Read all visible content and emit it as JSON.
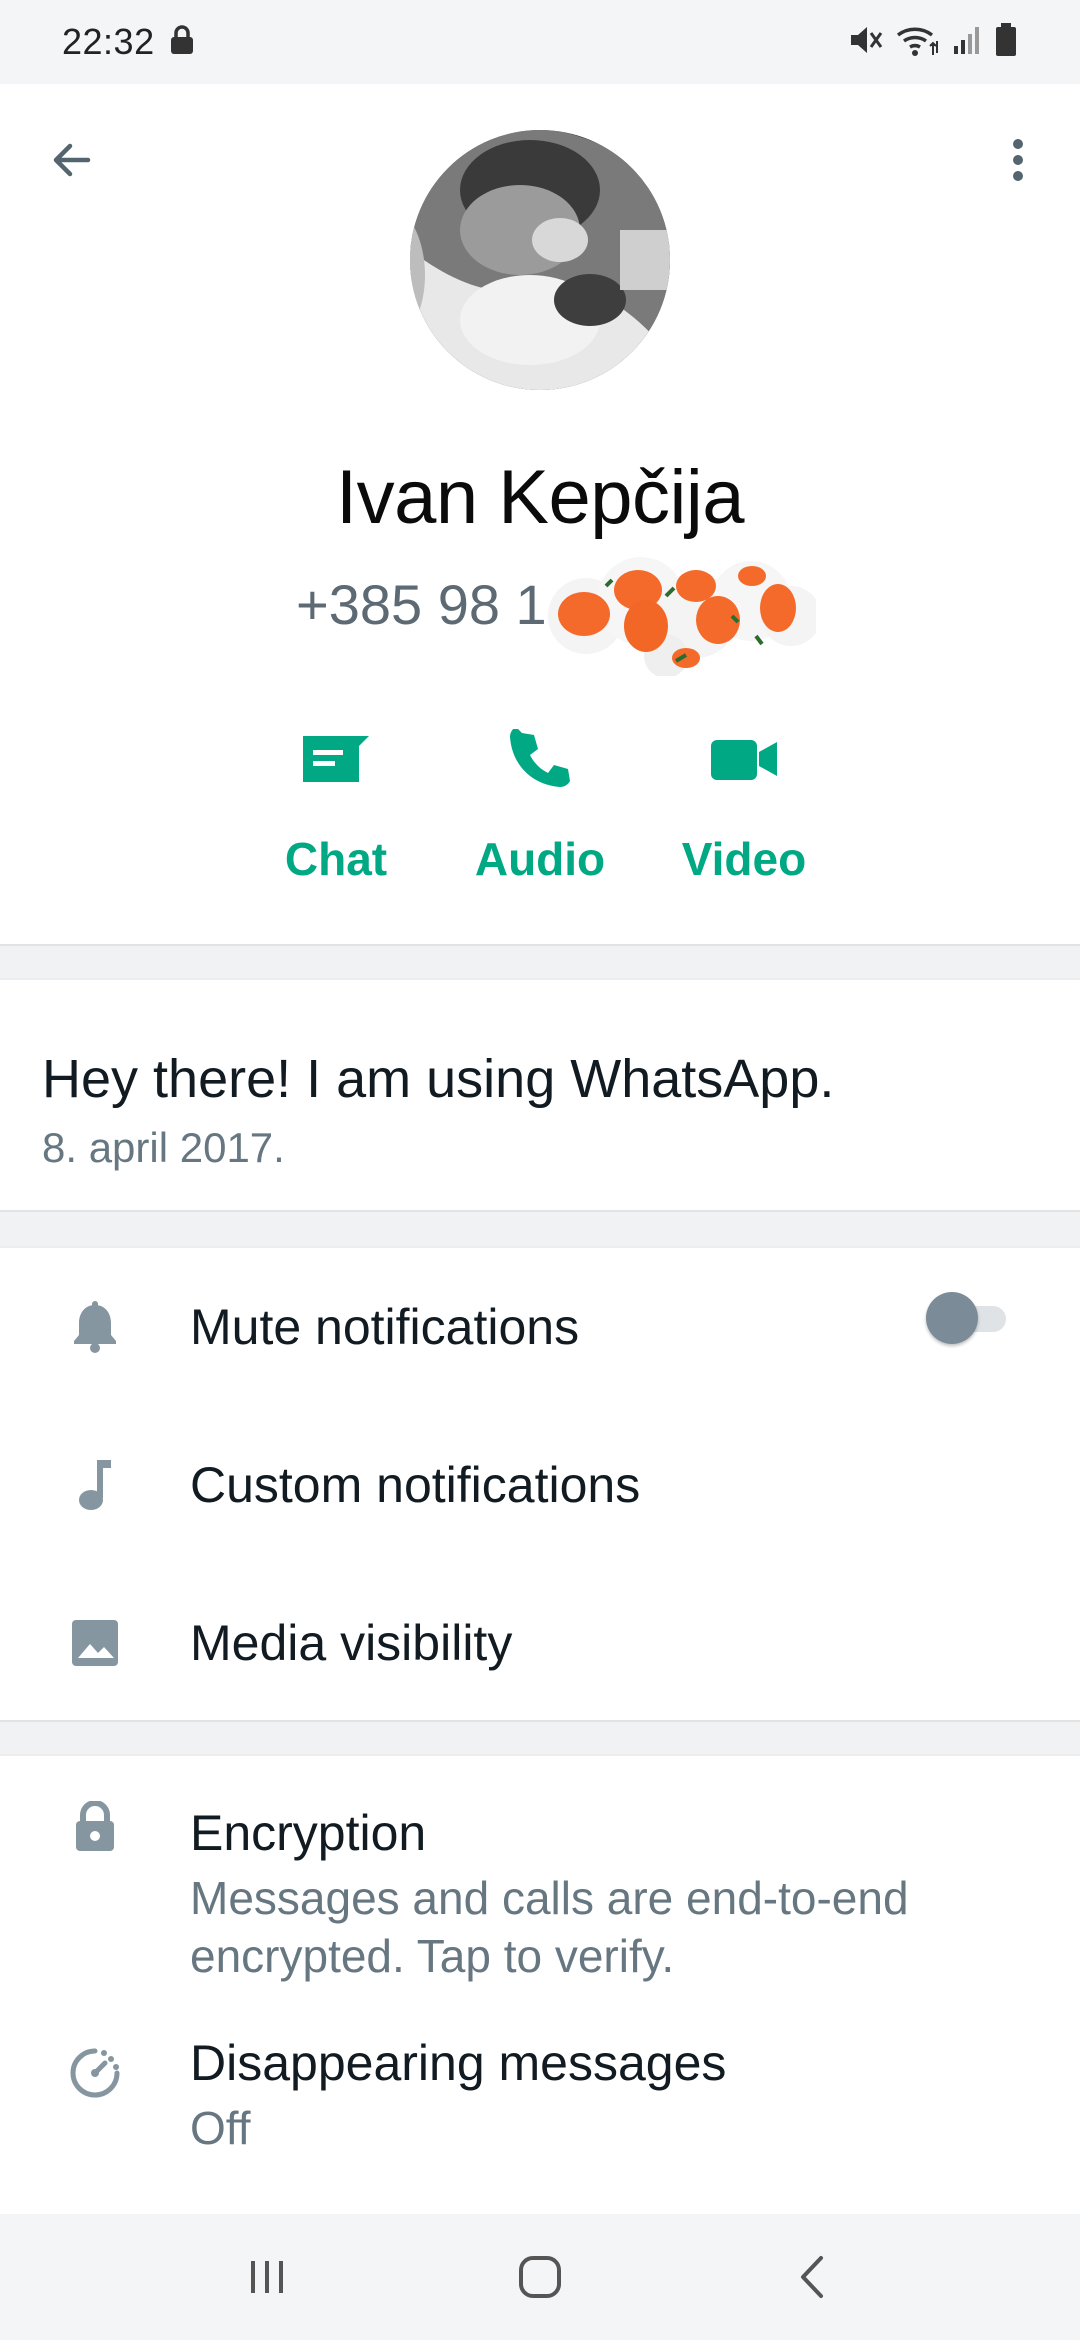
{
  "status_bar": {
    "time": "22:32"
  },
  "header": {
    "back_icon": "arrow-left-icon",
    "more_icon": "more-vert-icon"
  },
  "contact": {
    "name": "Ivan Kepčija",
    "phone": "+385 98 1"
  },
  "actions": [
    {
      "label": "Chat",
      "icon": "chat-icon"
    },
    {
      "label": "Audio",
      "icon": "phone-icon"
    },
    {
      "label": "Video",
      "icon": "video-icon"
    }
  ],
  "about": {
    "text": "Hey there! I am using WhatsApp.",
    "date": "8. april 2017."
  },
  "settings": {
    "mute": {
      "title": "Mute notifications",
      "icon": "bell-icon",
      "enabled": false
    },
    "custom": {
      "title": "Custom notifications",
      "icon": "music-note-icon"
    },
    "media": {
      "title": "Media visibility",
      "icon": "image-icon"
    },
    "encryption": {
      "title": "Encryption",
      "subtitle_line1": "Messages and calls are end-to-end",
      "subtitle_line2": "encrypted. Tap to verify.",
      "icon": "lock-icon"
    },
    "disappearing": {
      "title": "Disappearing messages",
      "subtitle": "Off",
      "icon": "timer-icon"
    }
  },
  "colors": {
    "accent": "#00a884",
    "icon_gray": "#8696a0",
    "secondary_text": "#667781"
  }
}
